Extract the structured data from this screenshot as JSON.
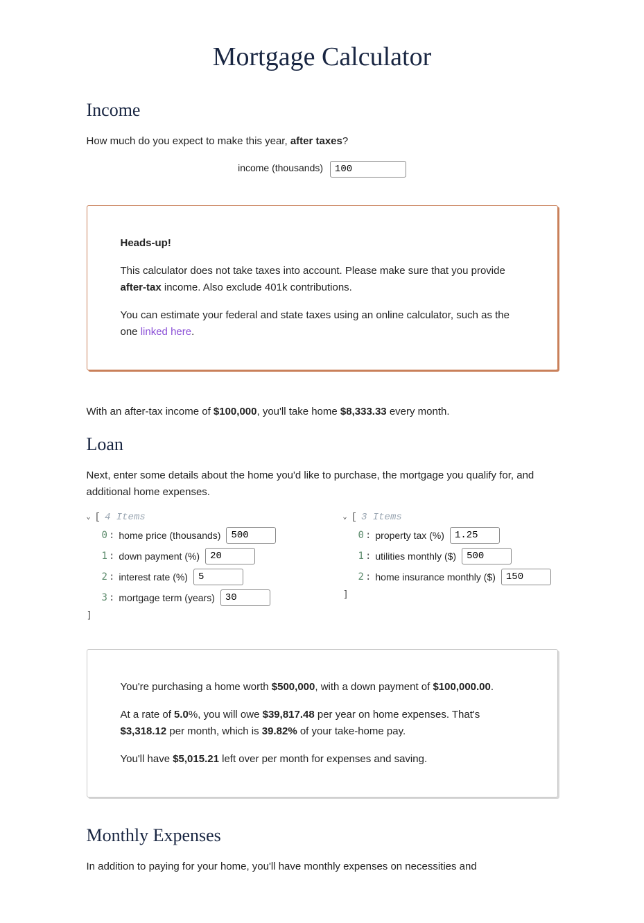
{
  "title": "Mortgage Calculator",
  "income": {
    "heading": "Income",
    "prompt_pre": "How much do you expect to make this year, ",
    "prompt_bold": "after taxes",
    "prompt_post": "?",
    "input_label": "income (thousands)",
    "input_value": "100"
  },
  "callout": {
    "heading": "Heads-up!",
    "line1_pre": "This calculator does not take taxes into account. Please make sure that you provide ",
    "line1_bold": "after-tax",
    "line1_post": " income. Also exclude 401k contributions.",
    "line2_pre": "You can estimate your federal and state taxes using an online calculator, such as the one ",
    "line2_link": "linked here",
    "line2_post": "."
  },
  "income_summary": {
    "pre": "With an after-tax income of ",
    "amount": "$100,000",
    "mid": ", you'll take home ",
    "monthly": "$8,333.33",
    "post": " every month."
  },
  "loan": {
    "heading": "Loan",
    "intro": "Next, enter some details about the home you'd like to purchase, the mortgage you qualify for, and additional home expenses."
  },
  "loan_list_a": {
    "meta": "4 Items",
    "items": [
      {
        "label": "home price (thousands)",
        "value": "500"
      },
      {
        "label": "down payment (%)",
        "value": "20"
      },
      {
        "label": "interest rate (%)",
        "value": "5"
      },
      {
        "label": "mortgage term (years)",
        "value": "30"
      }
    ]
  },
  "loan_list_b": {
    "meta": "3 Items",
    "items": [
      {
        "label": "property tax (%)",
        "value": "1.25"
      },
      {
        "label": "utilities monthly ($)",
        "value": "500"
      },
      {
        "label": "home insurance monthly ($)",
        "value": "150"
      }
    ]
  },
  "loan_summary": {
    "p1_pre": "You're purchasing a home worth ",
    "p1_price": "$500,000",
    "p1_mid": ", with a down payment of ",
    "p1_down": "$100,000.00",
    "p1_post": ".",
    "p2_pre": "At a rate of ",
    "p2_rate": "5.0",
    "p2_mid1": "%, you will owe ",
    "p2_yearly": "$39,817.48",
    "p2_mid2": " per year on home expenses. That's ",
    "p2_monthly": "$3,318.12",
    "p2_mid3": " per month, which is ",
    "p2_pct": "39.82%",
    "p2_post": " of your take-home pay.",
    "p3_pre": "You'll have ",
    "p3_left": "$5,015.21",
    "p3_post": " left over per month for expenses and saving."
  },
  "expenses": {
    "heading": "Monthly Expenses",
    "intro": "In addition to paying for your home, you'll have monthly expenses on necessities and"
  }
}
